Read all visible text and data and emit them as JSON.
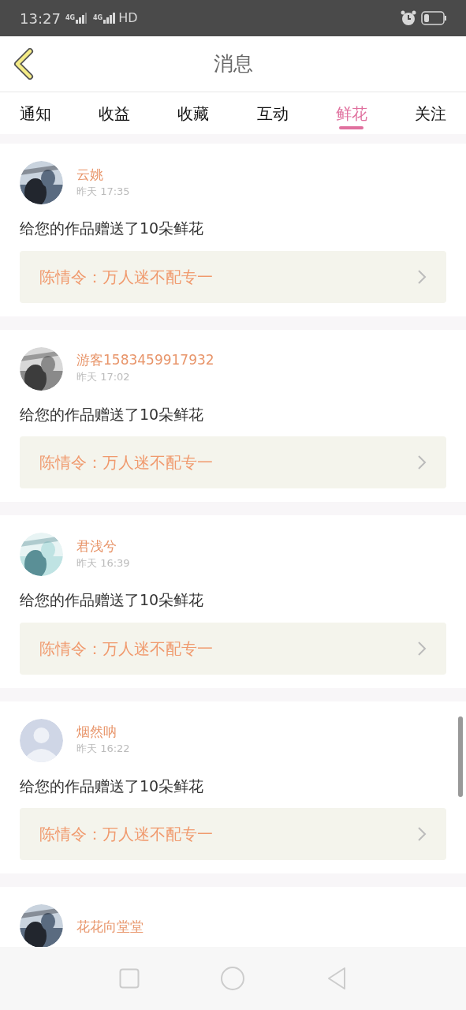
{
  "status_bar": {
    "time": "13:27",
    "sim1": "4G",
    "sim2": "4G",
    "hd": "HD"
  },
  "header": {
    "title": "消息"
  },
  "tabs": [
    {
      "label": "通知",
      "selected": false
    },
    {
      "label": "收益",
      "selected": false
    },
    {
      "label": "收藏",
      "selected": false
    },
    {
      "label": "互动",
      "selected": false
    },
    {
      "label": "鲜花",
      "selected": true
    },
    {
      "label": "关注",
      "selected": false
    }
  ],
  "messages": [
    {
      "name": "云姚",
      "time": "昨天 17:35",
      "text": "给您的作品赠送了10朵鲜花",
      "work": "陈情令：万人迷不配专一"
    },
    {
      "name": "游客1583459917932",
      "time": "昨天 17:02",
      "text": "给您的作品赠送了10朵鲜花",
      "work": "陈情令：万人迷不配专一"
    },
    {
      "name": "君浅兮",
      "time": "昨天 16:39",
      "text": "给您的作品赠送了10朵鲜花",
      "work": "陈情令：万人迷不配专一"
    },
    {
      "avatar": {
        "kind": "placeholder"
      },
      "name": "烟然呐",
      "time": "昨天 16:22",
      "text": "给您的作品赠送了10朵鲜花",
      "work": "陈情令：万人迷不配专一"
    },
    {
      "name": "花花向堂堂"
    }
  ]
}
